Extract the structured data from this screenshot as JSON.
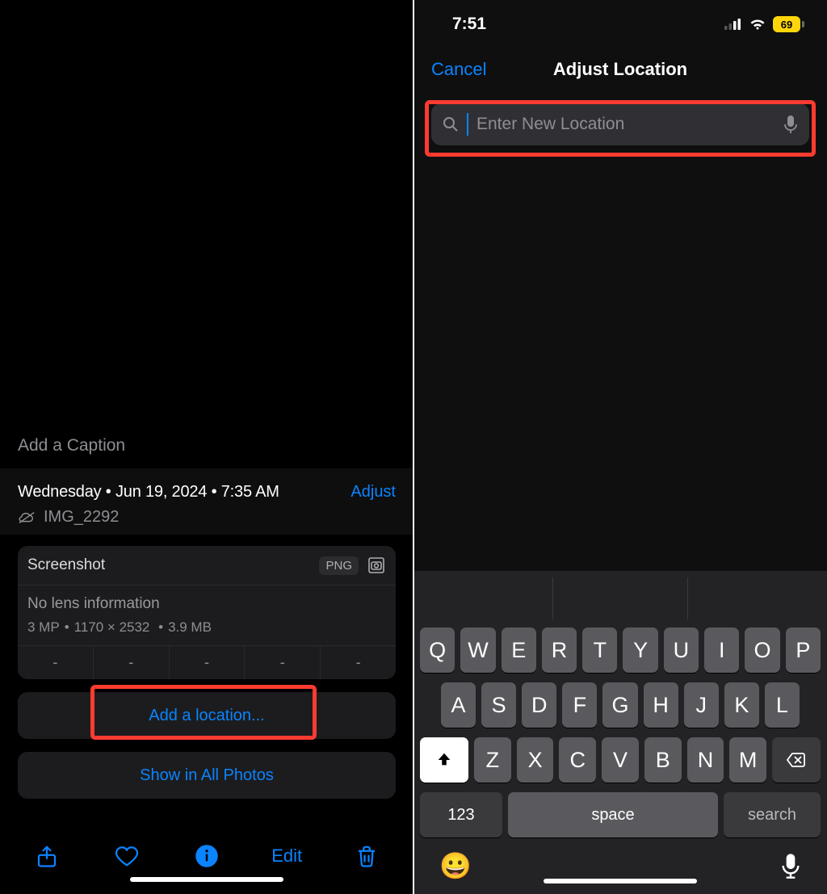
{
  "left": {
    "caption_placeholder": "Add a Caption",
    "date_line": "Wednesday • Jun 19, 2024 • 7:35 AM",
    "adjust_label": "Adjust",
    "filename": "IMG_2292",
    "meta": {
      "title": "Screenshot",
      "badge": "PNG",
      "lens": "No lens information",
      "mp": "3 MP",
      "dimensions": "1170 × 2532",
      "size": "3.9 MB",
      "dashes": [
        "-",
        "-",
        "-",
        "-",
        "-"
      ]
    },
    "add_location_label": "Add a location...",
    "show_all_label": "Show in All Photos",
    "toolbar": {
      "edit": "Edit"
    }
  },
  "right": {
    "status": {
      "time": "7:51",
      "battery": "69"
    },
    "sheet": {
      "cancel": "Cancel",
      "title": "Adjust Location",
      "search_placeholder": "Enter New Location"
    },
    "keyboard": {
      "row1": [
        "Q",
        "W",
        "E",
        "R",
        "T",
        "Y",
        "U",
        "I",
        "O",
        "P"
      ],
      "row2": [
        "A",
        "S",
        "D",
        "F",
        "G",
        "H",
        "J",
        "K",
        "L"
      ],
      "row3": [
        "Z",
        "X",
        "C",
        "V",
        "B",
        "N",
        "M"
      ],
      "numbers": "123",
      "space": "space",
      "search": "search"
    }
  }
}
